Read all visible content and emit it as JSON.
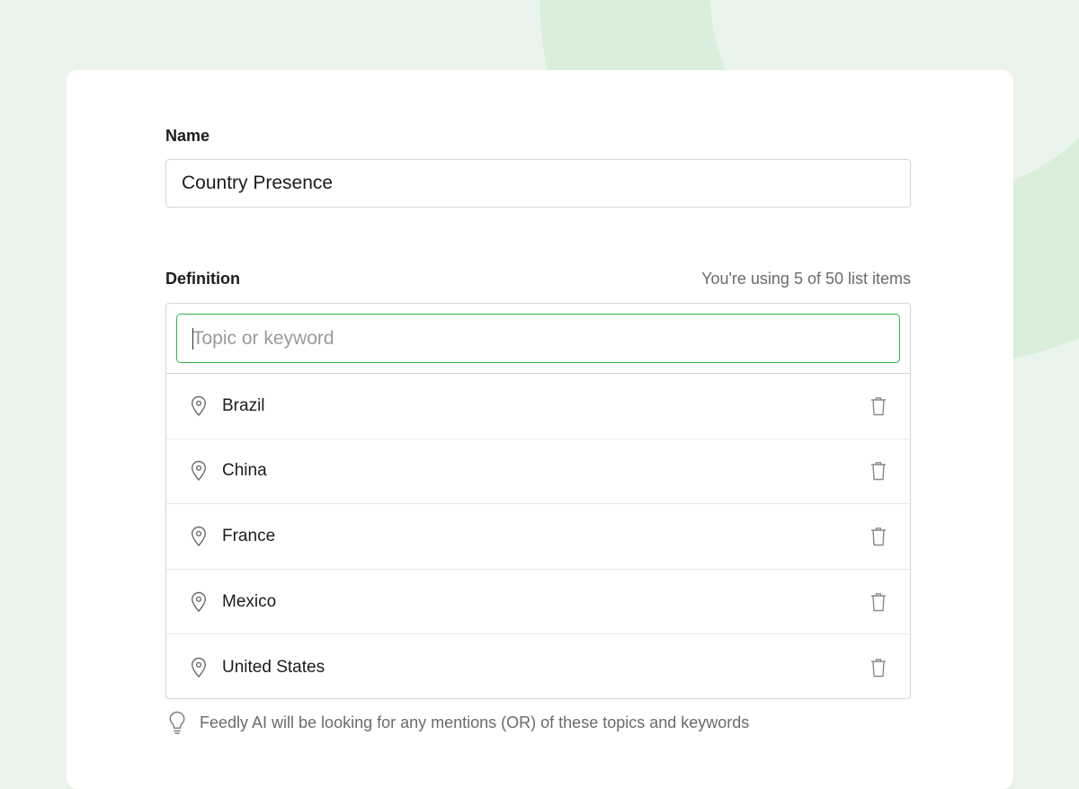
{
  "form": {
    "name_label": "Name",
    "name_value": "Country Presence",
    "definition_label": "Definition",
    "usage_text": "You're using 5 of 50 list items",
    "topic_placeholder": "Topic or keyword",
    "items": [
      {
        "label": "Brazil",
        "icon": "location-pin-icon"
      },
      {
        "label": "China",
        "icon": "location-pin-icon"
      },
      {
        "label": "France",
        "icon": "location-pin-icon"
      },
      {
        "label": "Mexico",
        "icon": "location-pin-icon"
      },
      {
        "label": "United States",
        "icon": "location-pin-icon"
      }
    ],
    "hint_text": "Feedly AI will be looking for any mentions (OR) of these topics and keywords",
    "hint_icon": "lightbulb-icon",
    "accent_color": "#2bb24c"
  }
}
